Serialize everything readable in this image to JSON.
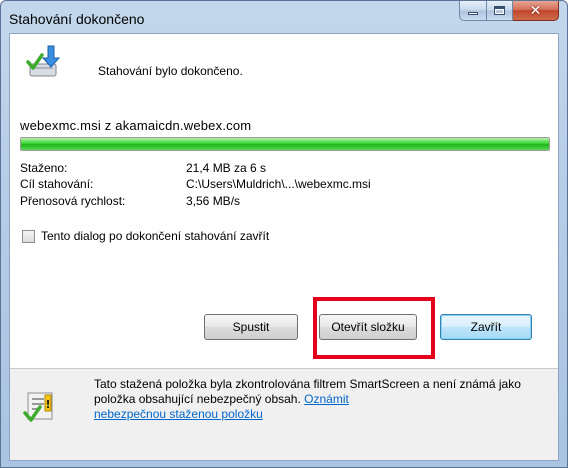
{
  "window": {
    "title": "Stahování dokončeno"
  },
  "main": {
    "status_text": "Stahování bylo dokončeno.",
    "source": "webexmc.msi z akamaicdn.webex.com",
    "progress_fraction": 1.0,
    "info": [
      {
        "label": "Staženo:",
        "value": "21,4 MB za 6 s"
      },
      {
        "label": "Cíl stahování:",
        "value": "C:\\Users\\Muldrich\\...\\webexmc.msi"
      },
      {
        "label": "Přenosová rychlost:",
        "value": "3,56 MB/s"
      }
    ],
    "close_on_complete_label": "Tento dialog po dokončení stahování zavřít",
    "close_on_complete_checked": false
  },
  "buttons": {
    "run": "Spustit",
    "open_folder": "Otevřít složku",
    "close": "Zavřít"
  },
  "footer": {
    "text": "Tato stažená položka byla zkontrolována filtrem SmartScreen a není známá jako položka obsahující nebezpečný obsah.",
    "link_part1": "Oznámit",
    "link_part2": "nebezpečnou staženou položku"
  },
  "colors": {
    "highlight": "#e3001b",
    "progress": "#1fb51a",
    "link": "#0066cc"
  },
  "icons": {
    "download_complete": "download-complete-icon",
    "smartscreen": "smartscreen-shield-icon"
  }
}
